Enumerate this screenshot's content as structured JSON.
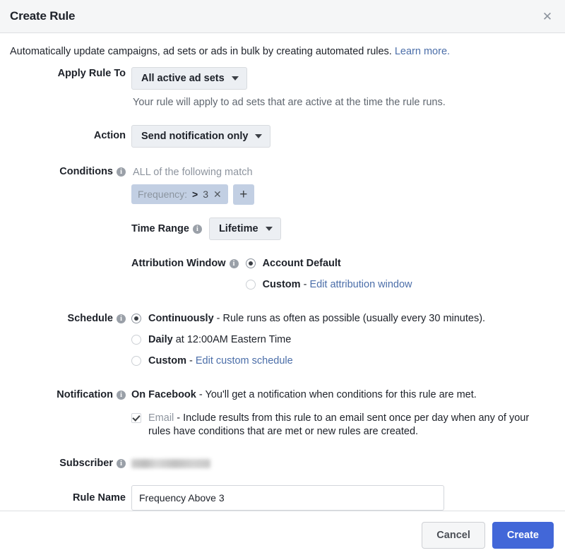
{
  "dialog": {
    "title": "Create Rule",
    "close_icon": "close-icon",
    "intro_text": "Automatically update campaigns, ad sets or ads in bulk by creating automated rules.",
    "intro_link": "Learn more."
  },
  "apply_rule_to": {
    "label": "Apply Rule To",
    "value": "All active ad sets",
    "helper": "Your rule will apply to ad sets that are active at the time the rule runs."
  },
  "action": {
    "label": "Action",
    "value": "Send notification only"
  },
  "conditions": {
    "label": "Conditions",
    "match_text": "ALL of the following match",
    "chips": [
      {
        "name": "Frequency:",
        "operator": ">",
        "value": "3",
        "remove_icon": "close-icon"
      }
    ],
    "add_label": "+"
  },
  "time_range": {
    "label": "Time Range",
    "value": "Lifetime"
  },
  "attribution_window": {
    "label": "Attribution Window",
    "options": [
      {
        "label": "Account Default",
        "selected": true,
        "suffix": "",
        "link": ""
      },
      {
        "label": "Custom",
        "selected": false,
        "suffix": " - ",
        "link": "Edit attribution window"
      }
    ]
  },
  "schedule": {
    "label": "Schedule",
    "options": [
      {
        "label": "Continuously",
        "selected": true,
        "suffix": " - Rule runs as often as possible (usually every 30 minutes).",
        "link": ""
      },
      {
        "label": "Daily",
        "selected": false,
        "suffix": " at 12:00AM Eastern Time",
        "link": ""
      },
      {
        "label": "Custom",
        "selected": false,
        "suffix": " - ",
        "link": "Edit custom schedule"
      }
    ]
  },
  "notification": {
    "label": "Notification",
    "on_facebook_title": "On Facebook",
    "on_facebook_text": " - You'll get a notification when conditions for this rule are met.",
    "email_checked": true,
    "email_title": "Email",
    "email_text": " - Include results from this rule to an email sent once per day when any of your rules have conditions that are met or new rules are created."
  },
  "subscriber": {
    "label": "Subscriber",
    "value": ""
  },
  "rule_name": {
    "label": "Rule Name",
    "value": "Frequency Above 3",
    "placeholder": ""
  },
  "footer": {
    "cancel_label": "Cancel",
    "create_label": "Create"
  },
  "colors": {
    "primary": "#4267d8",
    "link": "#4b6ea9",
    "chip": "#c2cfe3",
    "header_bg": "#f5f6f7"
  }
}
